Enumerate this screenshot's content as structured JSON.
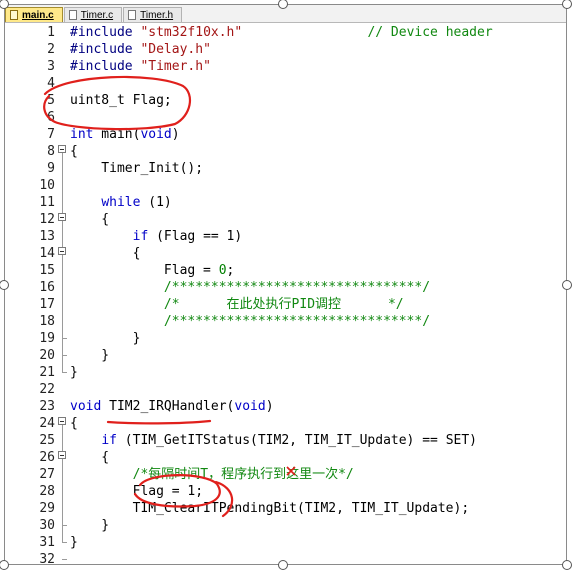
{
  "tabs": [
    {
      "label": "main.c",
      "active": true
    },
    {
      "label": "Timer.c",
      "active": false
    },
    {
      "label": "Timer.h",
      "active": false
    }
  ],
  "lines": [
    {
      "n": "1",
      "fold": "none",
      "tokens": [
        [
          "pp",
          "#include "
        ],
        [
          "str",
          "\"stm32f10x.h\""
        ],
        [
          "plain",
          "                "
        ],
        [
          "cm",
          "// Device header"
        ]
      ]
    },
    {
      "n": "2",
      "fold": "none",
      "tokens": [
        [
          "pp",
          "#include "
        ],
        [
          "str",
          "\"Delay.h\""
        ]
      ]
    },
    {
      "n": "3",
      "fold": "none",
      "tokens": [
        [
          "pp",
          "#include "
        ],
        [
          "str",
          "\"Timer.h\""
        ]
      ]
    },
    {
      "n": "4",
      "fold": "none",
      "tokens": []
    },
    {
      "n": "5",
      "fold": "none",
      "tokens": [
        [
          "plain",
          "uint8_t Flag;"
        ]
      ]
    },
    {
      "n": "6",
      "fold": "none",
      "tokens": []
    },
    {
      "n": "7",
      "fold": "none",
      "tokens": [
        [
          "kw",
          "int"
        ],
        [
          "plain",
          " main("
        ],
        [
          "kw",
          "void"
        ],
        [
          "plain",
          ")"
        ]
      ]
    },
    {
      "n": "8",
      "fold": "open",
      "tokens": [
        [
          "plain",
          "{"
        ]
      ]
    },
    {
      "n": "9",
      "fold": "none",
      "tokens": [
        [
          "plain",
          "    Timer_Init();"
        ]
      ]
    },
    {
      "n": "10",
      "fold": "none",
      "tokens": []
    },
    {
      "n": "11",
      "fold": "none",
      "tokens": [
        [
          "plain",
          "    "
        ],
        [
          "kw",
          "while"
        ],
        [
          "plain",
          " (1)"
        ]
      ]
    },
    {
      "n": "12",
      "fold": "open",
      "tokens": [
        [
          "plain",
          "    {"
        ]
      ]
    },
    {
      "n": "13",
      "fold": "none",
      "tokens": [
        [
          "plain",
          "        "
        ],
        [
          "kw",
          "if"
        ],
        [
          "plain",
          " (Flag == 1)"
        ]
      ]
    },
    {
      "n": "14",
      "fold": "open",
      "tokens": [
        [
          "plain",
          "        {"
        ]
      ]
    },
    {
      "n": "15",
      "fold": "none",
      "tokens": [
        [
          "plain",
          "            Flag = "
        ],
        [
          "num",
          "0"
        ],
        [
          "plain",
          ";"
        ]
      ]
    },
    {
      "n": "16",
      "fold": "none",
      "tokens": [
        [
          "plain",
          "            "
        ],
        [
          "cm",
          "/********************************/"
        ]
      ]
    },
    {
      "n": "17",
      "fold": "none",
      "tokens": [
        [
          "plain",
          "            "
        ],
        [
          "cm",
          "/*      在此处执行PID调控      */"
        ]
      ]
    },
    {
      "n": "18",
      "fold": "none",
      "tokens": [
        [
          "plain",
          "            "
        ],
        [
          "cm",
          "/********************************/"
        ]
      ]
    },
    {
      "n": "19",
      "fold": "end",
      "tokens": [
        [
          "plain",
          "        }"
        ]
      ]
    },
    {
      "n": "20",
      "fold": "end",
      "tokens": [
        [
          "plain",
          "    }"
        ]
      ]
    },
    {
      "n": "21",
      "fold": "end",
      "tokens": [
        [
          "plain",
          "}"
        ]
      ]
    },
    {
      "n": "22",
      "fold": "none",
      "tokens": []
    },
    {
      "n": "23",
      "fold": "none",
      "tokens": [
        [
          "kw",
          "void"
        ],
        [
          "plain",
          " TIM2_IRQHandler("
        ],
        [
          "kw",
          "void"
        ],
        [
          "plain",
          ")"
        ]
      ]
    },
    {
      "n": "24",
      "fold": "open",
      "tokens": [
        [
          "plain",
          "{"
        ]
      ]
    },
    {
      "n": "25",
      "fold": "none",
      "tokens": [
        [
          "plain",
          "    "
        ],
        [
          "kw",
          "if"
        ],
        [
          "plain",
          " (TIM_GetITStatus(TIM2, TIM_IT_Update) == SET)"
        ]
      ]
    },
    {
      "n": "26",
      "fold": "open",
      "tokens": [
        [
          "plain",
          "    {"
        ]
      ]
    },
    {
      "n": "27",
      "fold": "none",
      "tokens": [
        [
          "plain",
          "        "
        ],
        [
          "cm",
          "/*每隔时间T，程序执行到这里一次*/"
        ]
      ]
    },
    {
      "n": "28",
      "fold": "none",
      "tokens": [
        [
          "plain",
          "        Flag = 1;"
        ]
      ]
    },
    {
      "n": "29",
      "fold": "none",
      "tokens": [
        [
          "plain",
          "        TIM_ClearITPendingBit(TIM2, TIM_IT_Update);"
        ]
      ]
    },
    {
      "n": "30",
      "fold": "end",
      "tokens": [
        [
          "plain",
          "    }"
        ]
      ]
    },
    {
      "n": "31",
      "fold": "end",
      "tokens": [
        [
          "plain",
          "}"
        ]
      ]
    },
    {
      "n": "32",
      "fold": "end",
      "tokens": []
    }
  ],
  "colors": {
    "annotation": "#e0201c",
    "active_tab": "#ffe98a"
  }
}
